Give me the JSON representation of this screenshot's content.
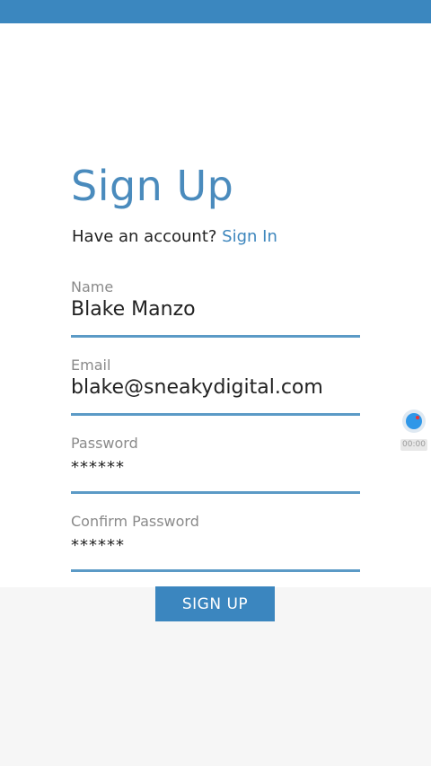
{
  "header": {
    "title": "Sign Up",
    "subtitle_text": "Have an account? ",
    "signin_link": "Sign In"
  },
  "form": {
    "name": {
      "label": "Name",
      "value": "Blake Manzo"
    },
    "email": {
      "label": "Email",
      "value": "blake@sneakydigital.com"
    },
    "password": {
      "label": "Password",
      "value": "******"
    },
    "confirm": {
      "label": "Confirm Password",
      "value": "******"
    }
  },
  "actions": {
    "signup_label": "SIGN UP"
  },
  "recorder": {
    "icon": "record-icon",
    "time": "00:00"
  },
  "colors": {
    "accent": "#3b86bf",
    "status_bar": "#3b87bf"
  }
}
